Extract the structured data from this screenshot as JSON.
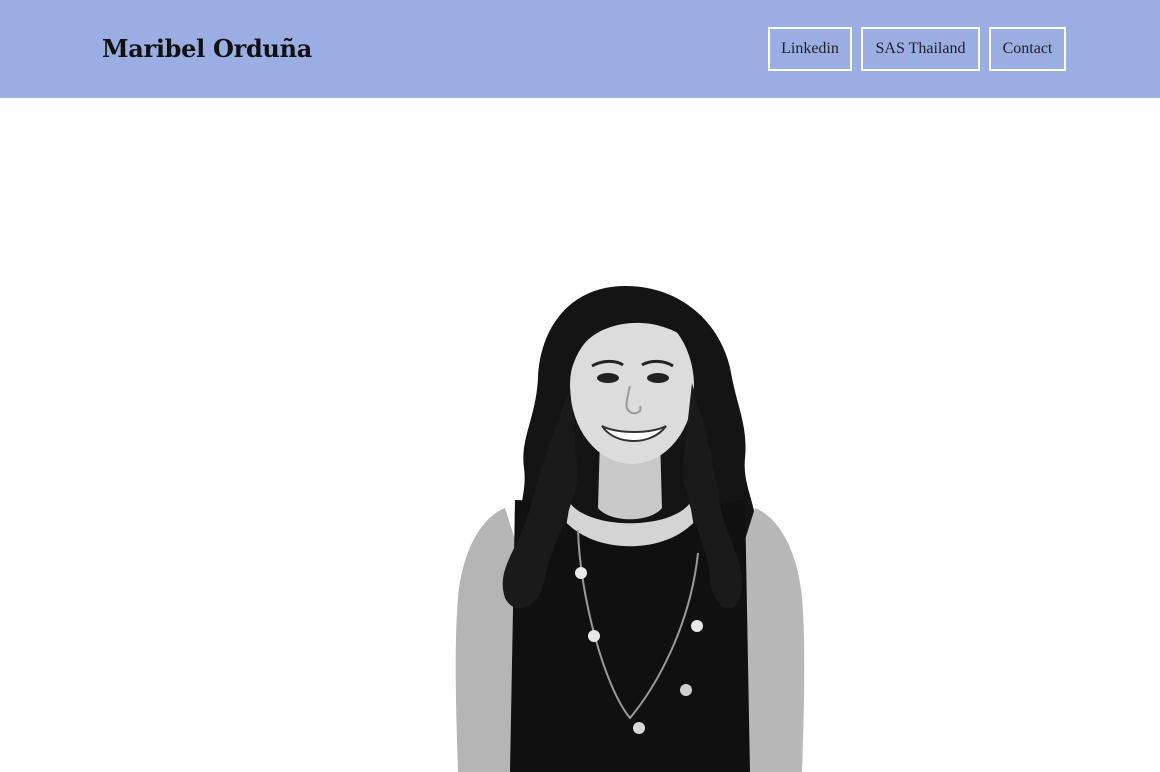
{
  "header": {
    "site_title": "Maribel Orduña",
    "background_color": "#9aaee3",
    "nav": [
      {
        "label": "Linkedin"
      },
      {
        "label": "SAS Thailand"
      },
      {
        "label": "Contact"
      }
    ]
  },
  "hero": {
    "image_style": "black-and-white"
  }
}
